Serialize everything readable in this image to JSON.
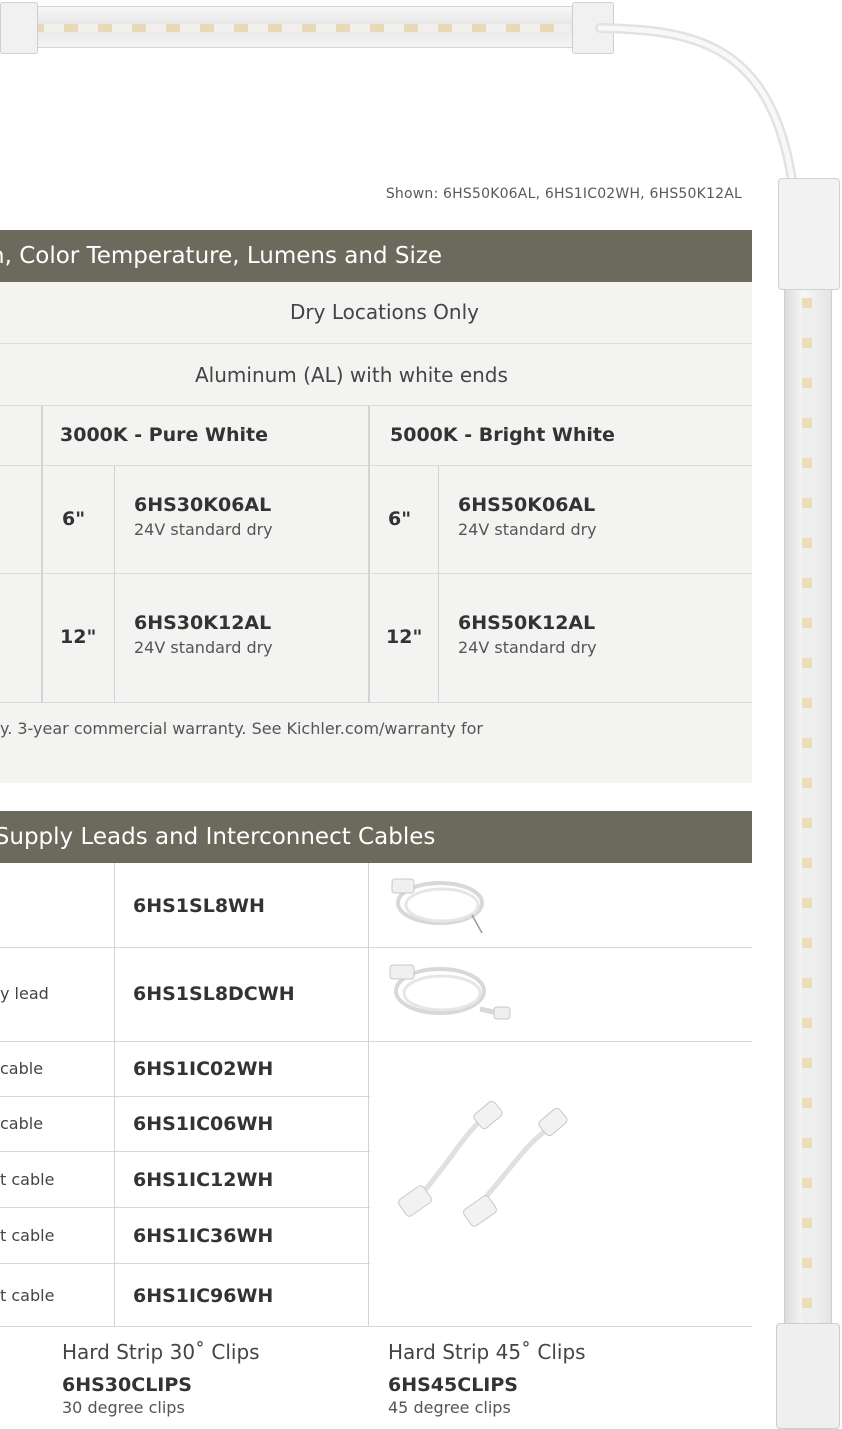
{
  "caption": "Shown: 6HS50K06AL, 6HS1IC02WH, 6HS50K12AL",
  "section1": {
    "title": "h, Color Temperature, Lumens and Size",
    "location_row": "Dry Locations Only",
    "finish_row": "Aluminum (AL) with white ends",
    "columns": [
      {
        "header": "3000K - Pure White"
      },
      {
        "header": "5000K - Bright White"
      }
    ],
    "rows": [
      {
        "cells": [
          {
            "size": "6\"",
            "sku": "6HS30K06AL",
            "desc": "24V standard dry"
          },
          {
            "size": "6\"",
            "sku": "6HS50K06AL",
            "desc": "24V standard dry"
          }
        ]
      },
      {
        "cells": [
          {
            "size": "12\"",
            "sku": "6HS30K12AL",
            "desc": "24V standard dry"
          },
          {
            "size": "12\"",
            "sku": "6HS50K12AL",
            "desc": "24V standard dry"
          }
        ]
      }
    ],
    "warranty": "y. 3-year commercial warranty. See Kichler.com/warranty for"
  },
  "section2": {
    "title": "r Supply Leads and Interconnect Cables",
    "rows": [
      {
        "label": "",
        "sku": "6HS1SL8WH"
      },
      {
        "label": "y lead",
        "sku": "6HS1SL8DCWH"
      },
      {
        "label": "cable",
        "sku": "6HS1IC02WH"
      },
      {
        "label": "cable",
        "sku": "6HS1IC06WH"
      },
      {
        "label": "t cable",
        "sku": "6HS1IC12WH"
      },
      {
        "label": "t cable",
        "sku": "6HS1IC36WH"
      },
      {
        "label": "t cable",
        "sku": "6HS1IC96WH"
      }
    ]
  },
  "clips": [
    {
      "title": "Hard Strip 30˚ Clips",
      "sku": "6HS30CLIPS",
      "desc": "30 degree clips"
    },
    {
      "title": "Hard Strip 45˚ Clips",
      "sku": "6HS45CLIPS",
      "desc": "45 degree clips"
    }
  ],
  "colors": {
    "bar": "#6c6a5c",
    "row_gray": "#f3f3f2",
    "text": "#3a3a3a"
  }
}
